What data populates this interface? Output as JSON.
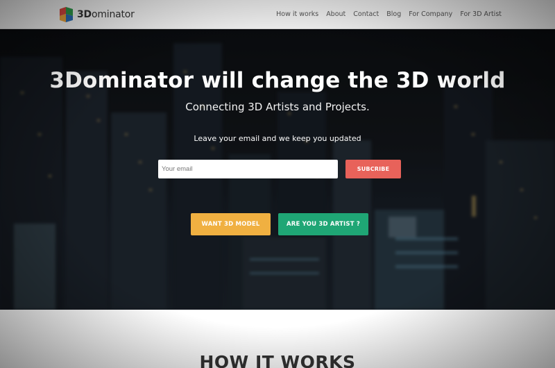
{
  "brand": {
    "logo_icon": "cube-logo-icon",
    "name_prefix": "3D",
    "name_rest": "ominator",
    "colors": {
      "red": "#d9473f",
      "green": "#2e9b4a",
      "blue": "#2b6db5",
      "orange": "#e9a23b"
    }
  },
  "nav": {
    "items": [
      {
        "label": "How it works"
      },
      {
        "label": "About"
      },
      {
        "label": "Contact"
      },
      {
        "label": "Blog"
      },
      {
        "label": "For Company"
      },
      {
        "label": "For 3D Artist"
      }
    ]
  },
  "hero": {
    "title": "3Dominator will change the 3D world",
    "subtitle": "Connecting 3D Artists and Projects.",
    "note": "Leave your email and we keep you updated",
    "email": {
      "placeholder": "Your email",
      "value": ""
    },
    "subscribe_label": "SUBCRIBE",
    "cta_model_label": "WANT 3D MODEL",
    "cta_artist_label": "ARE YOU 3D ARTIST ?"
  },
  "section": {
    "title": "HOW IT WORKS"
  },
  "colors": {
    "subscribe": "#e8625a",
    "cta_model": "#f0b041",
    "cta_artist": "#1fa675",
    "header_bg": "#f5f5f5"
  }
}
